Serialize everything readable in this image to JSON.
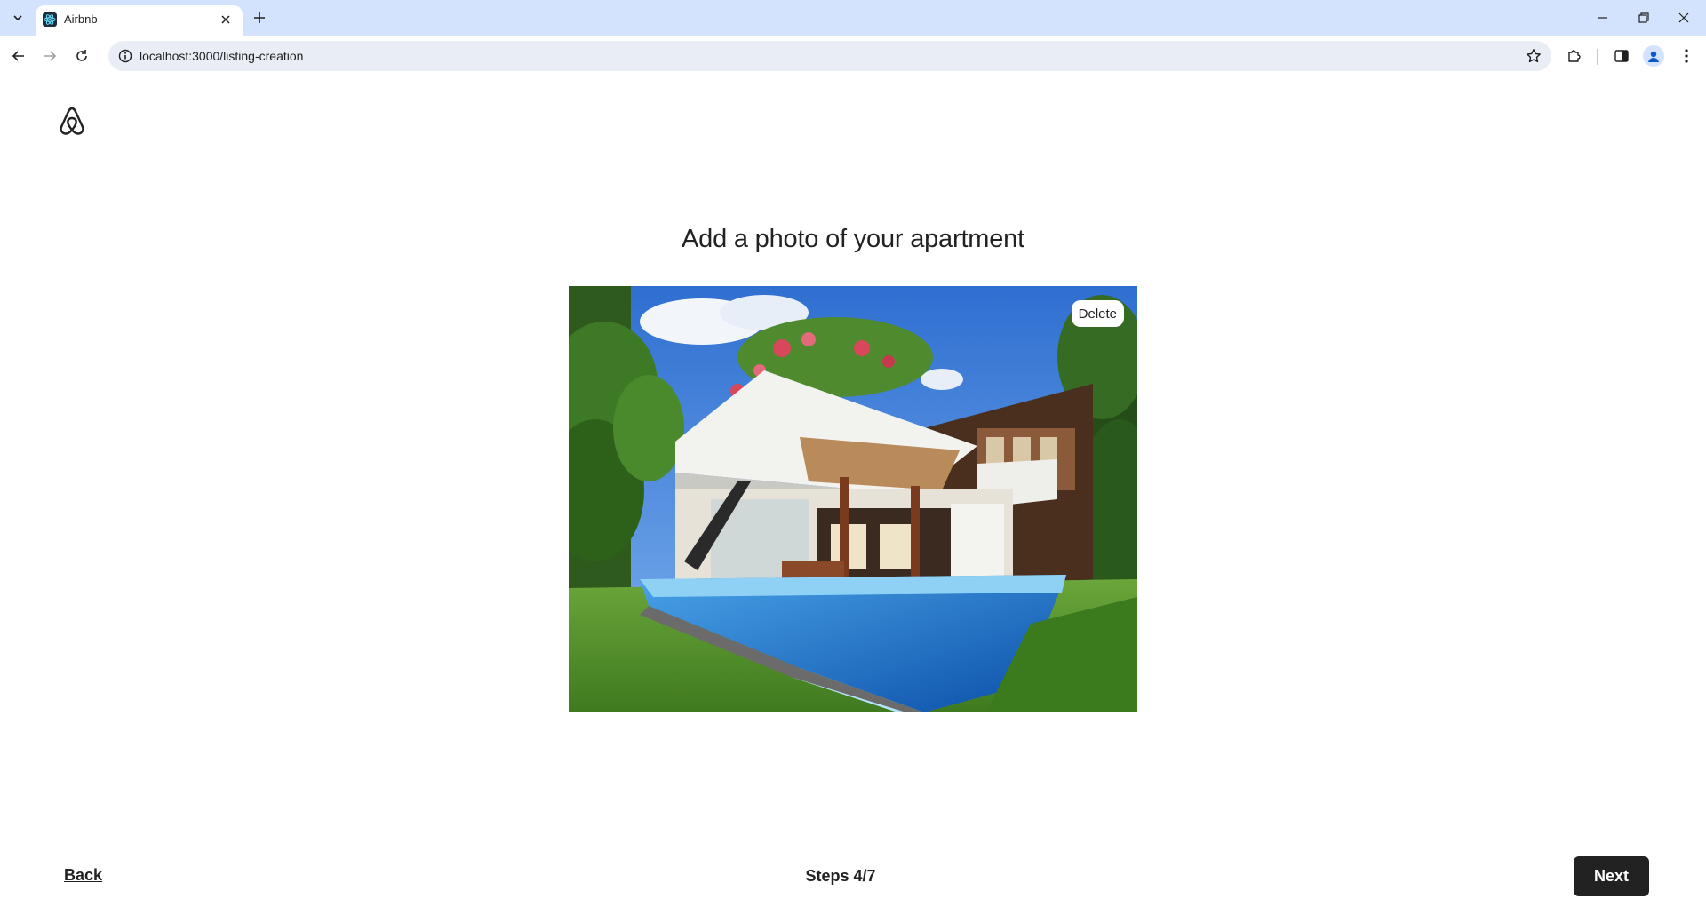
{
  "browser": {
    "tab_title": "Airbnb",
    "url": "localhost:3000/listing-creation"
  },
  "page": {
    "title": "Add a photo of your apartment",
    "photo": {
      "alt": "Modern house with pool",
      "delete_label": "Delete"
    },
    "footer": {
      "back_label": "Back",
      "steps_label": "Steps 4/7",
      "next_label": "Next"
    }
  },
  "colors": {
    "tabbar": "#d3e3fd",
    "primary_button": "#222222",
    "text": "#222222"
  }
}
